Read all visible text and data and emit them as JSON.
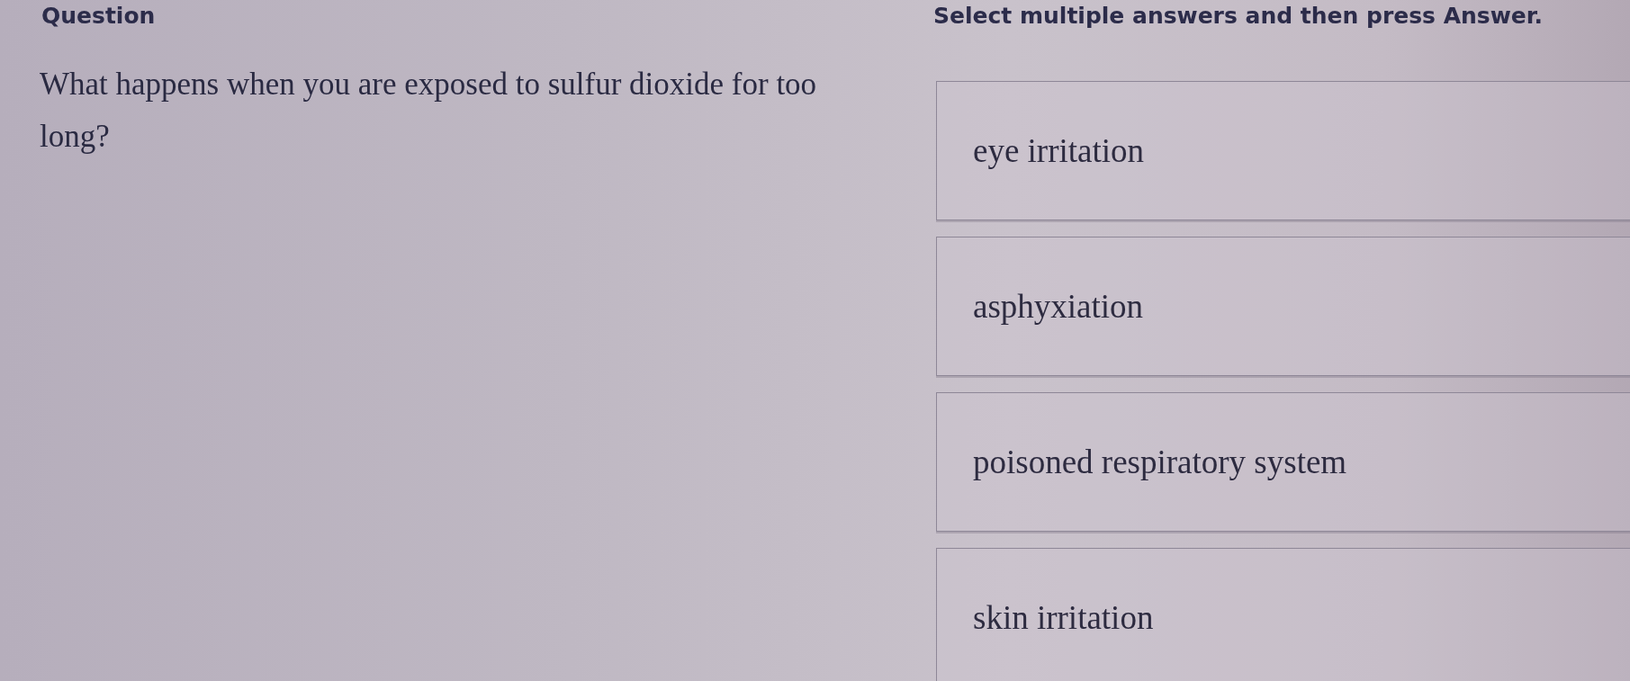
{
  "header": {
    "title": "Question",
    "instruction": "Select multiple answers and then press Answer."
  },
  "question": {
    "text": "What happens when you are exposed to sulfur dioxide for too long?"
  },
  "options": [
    {
      "label": "eye irritation"
    },
    {
      "label": "asphyxiation"
    },
    {
      "label": "poisoned respiratory system"
    },
    {
      "label": "skin irritation"
    }
  ]
}
